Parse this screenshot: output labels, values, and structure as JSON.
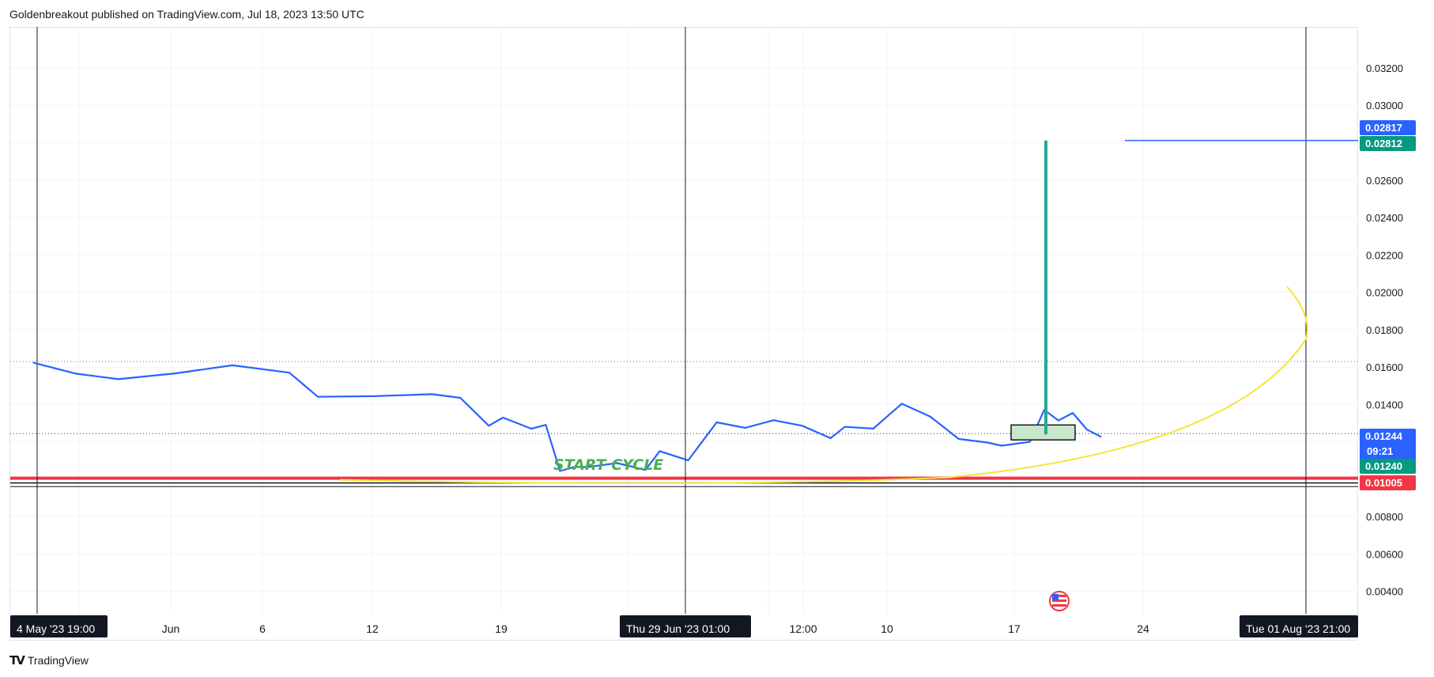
{
  "header": {
    "published_text": "Goldenbreakout published on TradingView.com, Jul 18, 2023 13:50 UTC"
  },
  "branding": {
    "logo_text": "TV",
    "name": "TradingView"
  },
  "icons": {
    "us_flag_icon": "us-flag-icon"
  },
  "colors": {
    "price_line": "#2962ff",
    "target_vertical": "#26a69a",
    "support_red": "#f23645",
    "curve_yellow": "#f5e43a",
    "box_fill": "#c8e6c9",
    "last_price_tag": "#2962ff",
    "green_tag": "#089981",
    "red_tag": "#f23645"
  },
  "chart_data": {
    "type": "line",
    "title": "",
    "xlabel": "",
    "ylabel": "",
    "ylim": [
      0.0028,
      0.0342
    ],
    "grid": true,
    "y_ticks": [
      "0.03200",
      "0.03000",
      "0.02600",
      "0.02400",
      "0.02200",
      "0.02000",
      "0.01800",
      "0.01600",
      "0.01400",
      "0.00800",
      "0.00600",
      "0.00400"
    ],
    "x_ticks": [
      "Jun",
      "6",
      "12",
      "19",
      "12:00",
      "10",
      "17",
      "24"
    ],
    "x_highlight_labels": [
      "4 May '23   19:00",
      "Thu 29 Jun '23   01:00",
      "Tue 01 Aug '23   21:00"
    ],
    "series": [
      {
        "x": [
          "2023-05-04",
          "2023-05-07",
          "2023-05-10",
          "2023-05-14",
          "2023-05-18",
          "2023-05-22",
          "2023-05-24",
          "2023-05-28",
          "2023-06-01",
          "2023-06-03",
          "2023-06-05",
          "2023-06-06",
          "2023-06-08",
          "2023-06-09",
          "2023-06-10",
          "2023-06-11",
          "2023-06-12",
          "2023-06-14",
          "2023-06-16",
          "2023-06-17",
          "2023-06-19",
          "2023-06-21",
          "2023-06-23",
          "2023-06-25",
          "2023-06-27",
          "2023-06-29",
          "2023-06-30",
          "2023-07-02",
          "2023-07-04",
          "2023-07-06",
          "2023-07-08",
          "2023-07-10",
          "2023-07-11",
          "2023-07-13",
          "2023-07-14",
          "2023-07-15",
          "2023-07-16",
          "2023-07-17",
          "2023-07-18"
        ],
        "values": [
          0.0161,
          0.0156,
          0.0154,
          0.0158,
          0.016,
          0.0157,
          0.0145,
          0.0143,
          0.0145,
          0.0144,
          0.013,
          0.0132,
          0.0127,
          0.013,
          0.0103,
          0.0106,
          0.0107,
          0.011,
          0.0104,
          0.0115,
          0.0111,
          0.0129,
          0.0127,
          0.0132,
          0.013,
          0.0121,
          0.0128,
          0.0128,
          0.0139,
          0.0133,
          0.0122,
          0.0121,
          0.0117,
          0.012,
          0.0138,
          0.013,
          0.0135,
          0.0127,
          0.0124
        ]
      }
    ],
    "horizontal_levels": {
      "support_red": 0.01005,
      "black_line_1": 0.0098,
      "black_line_2": 0.0096,
      "dotted_upper": 0.0163,
      "dotted_current": 0.01244,
      "target_blue": 0.02812
    },
    "price_labels": [
      {
        "value": "0.02817",
        "role": "blue"
      },
      {
        "value": "0.02812",
        "role": "green"
      },
      {
        "value": "0.01244",
        "role": "last"
      },
      {
        "value": "09:21",
        "role": "countdown"
      },
      {
        "value": "0.01240",
        "role": "green"
      },
      {
        "value": "0.01005",
        "role": "red"
      }
    ],
    "annotations": [
      {
        "text": "START CYCLE"
      }
    ],
    "target_vertical": {
      "from": 0.0124,
      "to": 0.02812
    },
    "current_box": {
      "low": 0.0121,
      "high": 0.0129
    }
  }
}
